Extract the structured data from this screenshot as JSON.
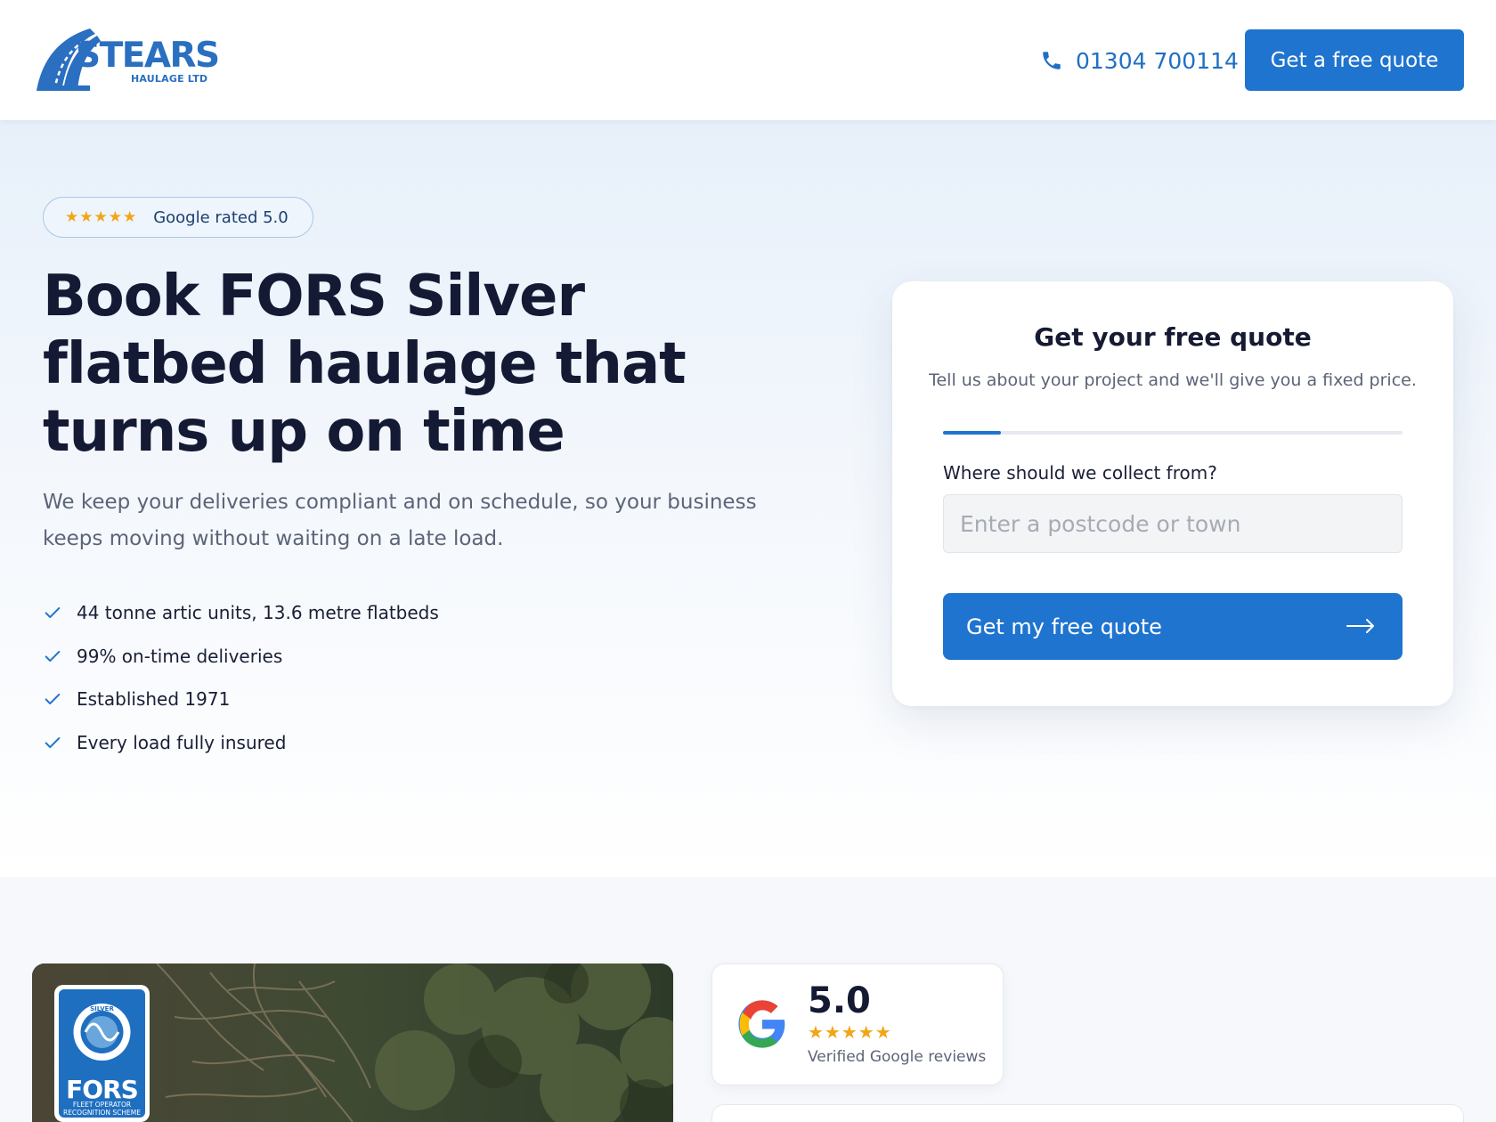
{
  "brand": {
    "name": "STEARS",
    "subtitle": "HAULAGE LTD",
    "accent_color": "#1f74cf"
  },
  "header": {
    "phone_icon": "phone-icon",
    "phone_number": "01304 700114",
    "cta_label": "Get a free quote"
  },
  "hero": {
    "rating_stars": "★★★★★",
    "rating_label": "Google rated 5.0",
    "title": "Book FORS Silver flatbed haulage that turns up on time",
    "subtitle": "We keep your deliveries compliant and on schedule, so your business keeps moving without waiting on a late load.",
    "features": [
      "44 tonne artic units, 13.6 metre flatbeds",
      "99% on-time deliveries",
      "Established 1971",
      "Every load fully insured"
    ]
  },
  "quote_form": {
    "title": "Get your free quote",
    "subtitle": "Tell us about your project and we'll give you a fixed price.",
    "progress": 0.125,
    "field_label": "Where should we collect from?",
    "field_placeholder": "Enter a postcode or town",
    "field_value": "",
    "submit_label": "Get my free quote",
    "submit_icon": "arrow-right-icon"
  },
  "badge": {
    "top_text": "SILVER",
    "name": "FORS",
    "caption_line1": "FLEET OPERATOR",
    "caption_line2": "RECOGNITION SCHEME"
  },
  "reviews": {
    "score": "5.0",
    "stars": "★★★★★",
    "label": "Verified Google reviews"
  }
}
